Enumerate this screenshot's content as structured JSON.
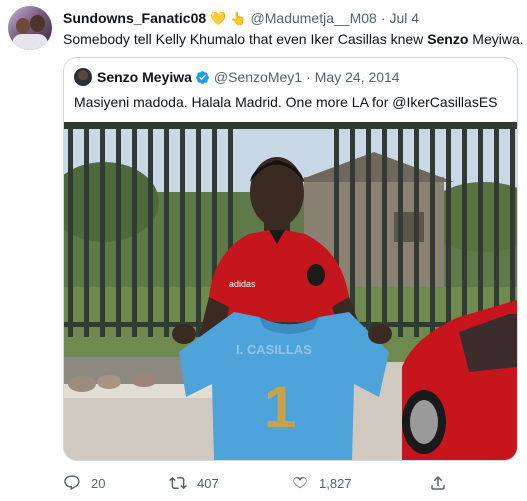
{
  "tweet": {
    "display_name": "Sundowns_Fanatic08",
    "name_emojis": [
      "💛",
      "👆"
    ],
    "handle": "@Madumetja__M08",
    "separator": "·",
    "date": "Jul 4",
    "text_before": "Somebody tell Kelly Khumalo that even Iker Casillas knew ",
    "text_bold": "Senzo",
    "text_after": " Meyiwa."
  },
  "quoted": {
    "display_name": "Senzo Meyiwa",
    "handle": "@SenzoMey1",
    "separator": "·",
    "date": "May 24, 2014",
    "text": "Masiyeni madoda. Halala Madrid. One more LA for @IkerCasillasES",
    "photo": {
      "jersey_print": "I. CASILLAS",
      "jersey_number": "1",
      "shirt_brand": "adidas"
    }
  },
  "actions": {
    "reply_count": "20",
    "retweet_count": "407",
    "like_count": "1,827"
  },
  "colors": {
    "text_primary": "#0f1419",
    "text_secondary": "#536471",
    "border": "#cfd9de",
    "verified": "#1d9bf0",
    "heart_emoji": "#f5c518"
  },
  "icons": [
    "reply-icon",
    "retweet-icon",
    "like-icon",
    "share-icon",
    "verified-badge-icon"
  ]
}
